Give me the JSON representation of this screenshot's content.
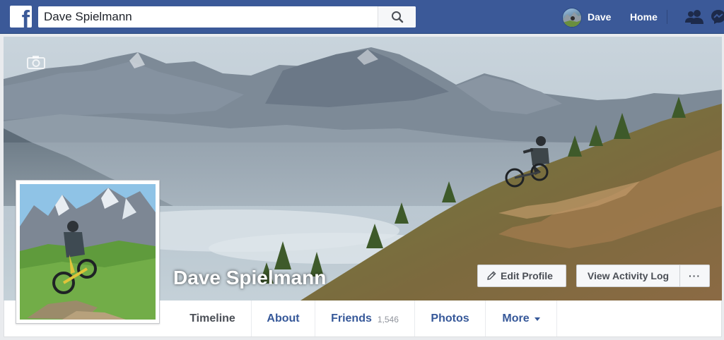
{
  "header": {
    "search_value": "Dave Spielmann",
    "search_placeholder": "Search",
    "user_name": "Dave",
    "home_label": "Home",
    "icons": [
      "facebook-logo",
      "search-icon",
      "friend-requests-icon",
      "messages-icon"
    ],
    "colors": {
      "bar": "#3b5998",
      "text": "#ffffff"
    }
  },
  "cover": {
    "profile_name": "Dave Spielmann",
    "edit_profile_label": "Edit Profile",
    "view_activity_log_label": "View Activity Log",
    "more_options_label": "···",
    "camera_icon": "camera-icon"
  },
  "tabs": [
    {
      "label": "Timeline",
      "active": true
    },
    {
      "label": "About"
    },
    {
      "label": "Friends",
      "count": "1,546"
    },
    {
      "label": "Photos"
    },
    {
      "label": "More"
    }
  ],
  "colors": {
    "link": "#365899",
    "active_tab": "#4b4f56",
    "page_bg": "#e9ebee"
  }
}
